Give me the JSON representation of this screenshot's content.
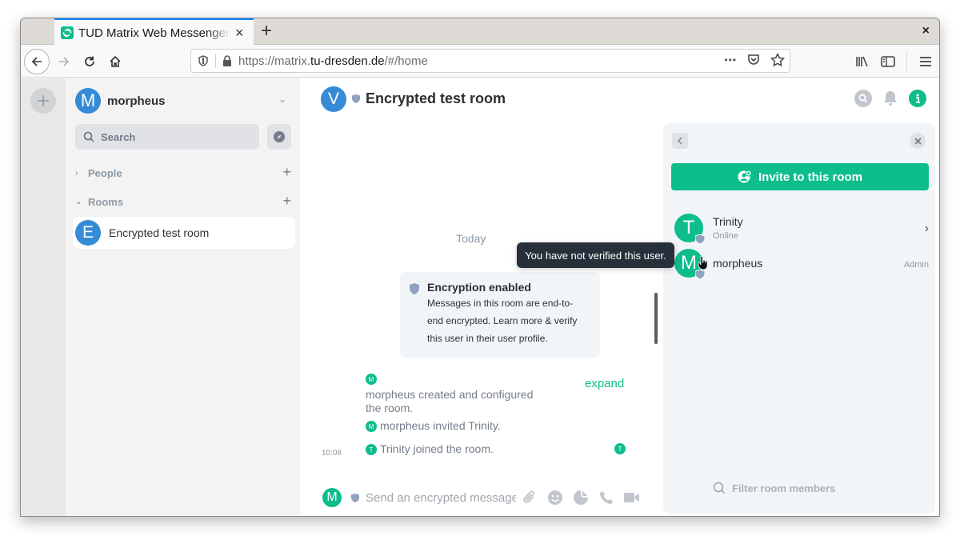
{
  "browser": {
    "tab_title": "TUD Matrix Web Messenger",
    "tab_close": "×",
    "new_tab": "+",
    "window_close": "×",
    "url_prefix": "https://matrix.",
    "url_domain": "tu-dresden.de",
    "url_suffix": "/#/home",
    "url_more": "•••"
  },
  "sidebar": {
    "user": {
      "initial": "M",
      "name": "morpheus"
    },
    "search_placeholder": "Search",
    "sections": [
      {
        "label": "People",
        "expanded": false
      },
      {
        "label": "Rooms",
        "expanded": true
      }
    ],
    "rooms": [
      {
        "initial": "E",
        "name": "Encrypted test room",
        "selected": true
      }
    ]
  },
  "room": {
    "avatar_initial": "V",
    "title": "Encrypted test room",
    "colors": {
      "accent": "#0dbd8b",
      "shield": "#91a1c0",
      "avatar_blue": "#368bd6"
    }
  },
  "timeline": {
    "date_separator": "Today",
    "encryption_notice": {
      "title": "Encryption enabled",
      "line1": "Messages in this room are end-to-",
      "line2": "end encrypted. Learn more & verify",
      "line3": "this user in their user profile."
    },
    "events": [
      {
        "avatar": "M",
        "line1": "morpheus created and configured",
        "line2": "the room."
      },
      {
        "avatar": "M",
        "text": "morpheus invited Trinity."
      },
      {
        "avatar": "T",
        "text": "Trinity joined the room.",
        "timestamp": "10:08",
        "read_receipt": "T"
      }
    ],
    "expand_label": "expand"
  },
  "composer": {
    "avatar_initial": "M",
    "placeholder": "Send an encrypted message…"
  },
  "right_panel": {
    "invite_label": "Invite to this room",
    "members": [
      {
        "initial": "T",
        "name": "Trinity",
        "status": "Online",
        "power": ""
      },
      {
        "initial": "M",
        "name": "morpheus",
        "status": "",
        "power": "Admin"
      }
    ],
    "filter_placeholder": "Filter room members"
  },
  "tooltip": {
    "text": "You have not verified this user."
  }
}
